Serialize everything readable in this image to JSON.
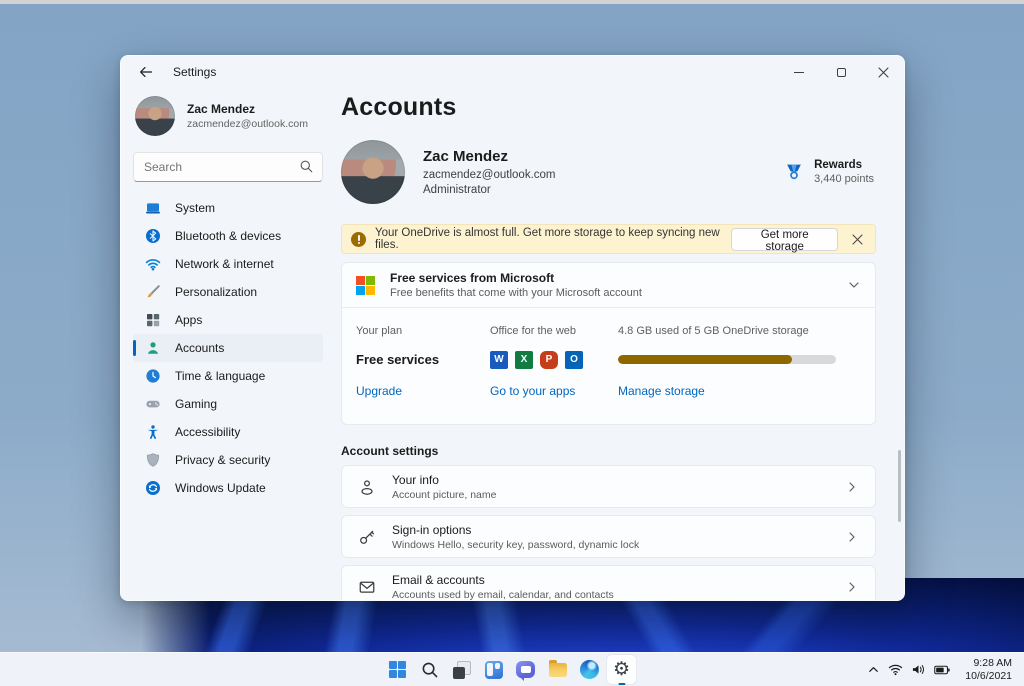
{
  "titlebar": {
    "app_title": "Settings"
  },
  "sidebar": {
    "user": {
      "name": "Zac Mendez",
      "email": "zacmendez@outlook.com"
    },
    "search": {
      "placeholder": "Search"
    },
    "items": [
      {
        "label": "System",
        "icon": "system-icon"
      },
      {
        "label": "Bluetooth & devices",
        "icon": "bluetooth-icon"
      },
      {
        "label": "Network & internet",
        "icon": "network-icon"
      },
      {
        "label": "Personalization",
        "icon": "personalization-icon"
      },
      {
        "label": "Apps",
        "icon": "apps-icon"
      },
      {
        "label": "Accounts",
        "icon": "accounts-icon",
        "selected": true
      },
      {
        "label": "Time & language",
        "icon": "time-language-icon"
      },
      {
        "label": "Gaming",
        "icon": "gaming-icon"
      },
      {
        "label": "Accessibility",
        "icon": "accessibility-icon"
      },
      {
        "label": "Privacy & security",
        "icon": "privacy-icon"
      },
      {
        "label": "Windows Update",
        "icon": "windows-update-icon"
      }
    ]
  },
  "main": {
    "page_title": "Accounts",
    "profile": {
      "name": "Zac Mendez",
      "email": "zacmendez@outlook.com",
      "role": "Administrator"
    },
    "rewards": {
      "label": "Rewards",
      "points": "3,440 points"
    },
    "onedrive_banner": {
      "message": "Your OneDrive is almost full. Get more storage to keep syncing new files.",
      "action": "Get more storage"
    },
    "free_services": {
      "title": "Free services from Microsoft",
      "subtitle": "Free benefits that come with your Microsoft account",
      "columns": {
        "plan": {
          "label": "Your plan",
          "value": "Free services",
          "link": "Upgrade"
        },
        "office": {
          "label": "Office for the web",
          "apps": [
            "W",
            "X",
            "P",
            "O"
          ],
          "link": "Go to your apps"
        },
        "storage": {
          "label": "4.8 GB used of 5 GB OneDrive storage",
          "percent_used": 80,
          "link": "Manage storage"
        }
      }
    },
    "account_settings": {
      "heading": "Account settings",
      "rows": [
        {
          "title": "Your info",
          "subtitle": "Account picture, name"
        },
        {
          "title": "Sign-in options",
          "subtitle": "Windows Hello, security key, password, dynamic lock"
        },
        {
          "title": "Email & accounts",
          "subtitle": "Accounts used by email, calendar, and contacts"
        }
      ]
    }
  },
  "taskbar": {
    "icons": [
      "start",
      "search",
      "task-view",
      "widgets",
      "chat",
      "file-explorer",
      "edge",
      "settings"
    ],
    "active_icon": "settings",
    "tray": {
      "time": "9:28 AM",
      "date": "10/6/2021"
    }
  },
  "colors": {
    "accent": "#0067c0",
    "warning_banner_bg": "#fdf3d1",
    "warning_icon": "#9d6a00",
    "storage_fill": "#8e6700",
    "office_word": "#185abd",
    "office_excel": "#107c41",
    "office_powerpoint": "#c43e1c",
    "office_outlook": "#0364b8"
  }
}
